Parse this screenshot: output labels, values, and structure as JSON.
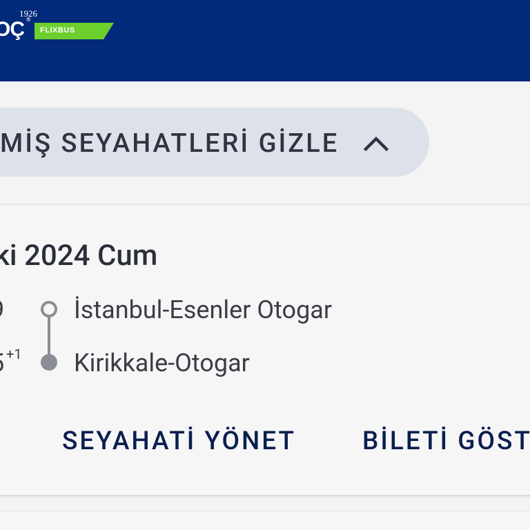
{
  "header": {
    "logo_year": "1926",
    "logo_brand": "OÇ",
    "logo_reg": "®",
    "partner_badge": "FLIXBUS",
    "colors": {
      "background": "#03297a",
      "badge": "#6ccf2e"
    }
  },
  "past_trips_toggle": {
    "label": "MİŞ SEYAHATLERİ GİZLE",
    "icon": "chevron-up-icon"
  },
  "trip": {
    "date": "ki 2024 Cum",
    "departure_time": "9",
    "arrival_time": "5",
    "arrival_day_offset": "+1",
    "origin": "İstanbul-Esenler Otogar",
    "destination": "Kirikkale-Otogar",
    "actions": {
      "manage": "SEYAHATİ YÖNET",
      "show_ticket": "BİLETİ GÖST"
    }
  }
}
